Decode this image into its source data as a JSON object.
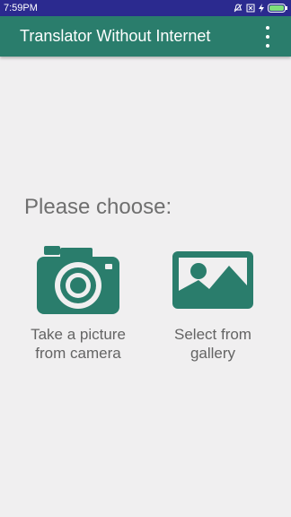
{
  "status_bar": {
    "time": "7:59PM",
    "icons": [
      "bell-off-icon",
      "sim-x-icon",
      "charging-icon",
      "battery-icon"
    ]
  },
  "app_bar": {
    "title": "Translator Without Internet",
    "menu_icon": "more-vert-icon"
  },
  "main": {
    "prompt": "Please choose:",
    "options": [
      {
        "label": "Take a picture\nfrom camera",
        "icon": "camera-icon"
      },
      {
        "label": "Select from\ngallery",
        "icon": "image-gallery-icon"
      }
    ]
  },
  "colors": {
    "status_bar": "#2b2a8f",
    "app_bar": "#2a7d6c",
    "accent": "#2a7d6c",
    "background": "#f0eff0"
  }
}
